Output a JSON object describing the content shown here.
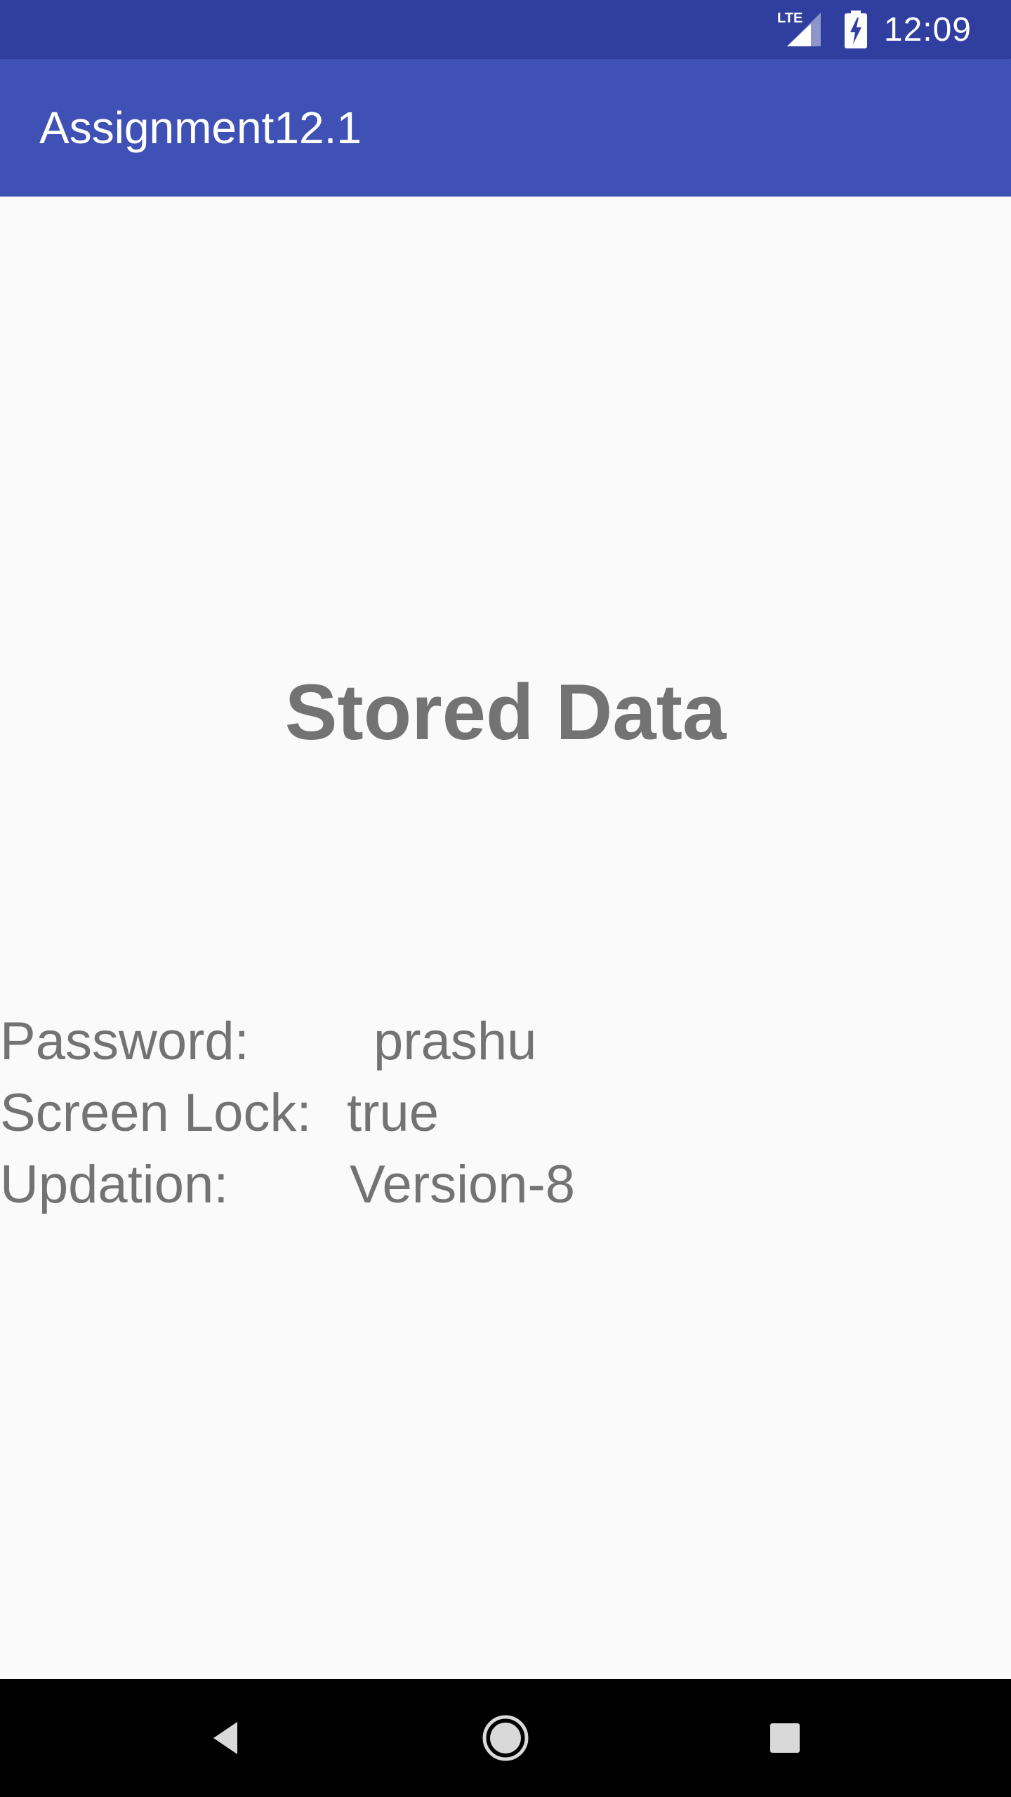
{
  "status_bar": {
    "network": "LTE",
    "time": "12:09",
    "icons": [
      "lte-icon",
      "signal-icon",
      "battery-charging-icon"
    ]
  },
  "app_bar": {
    "title": "Assignment12.1",
    "color": "#3f51b5",
    "status_color": "#303f9f"
  },
  "main": {
    "heading": "Stored Data",
    "rows": [
      {
        "label": "Password:",
        "value": "prashu"
      },
      {
        "label": "Screen Lock:",
        "value": "true"
      },
      {
        "label": "Updation:",
        "value": "Version-8"
      }
    ],
    "text_color": "#737373"
  },
  "nav_bar": {
    "buttons": [
      "back-icon",
      "home-icon",
      "recents-icon"
    ]
  }
}
